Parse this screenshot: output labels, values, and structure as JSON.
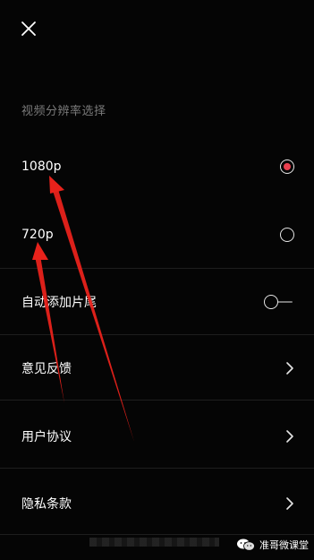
{
  "header": {
    "close_icon": "close-icon"
  },
  "resolution": {
    "section_title": "视频分辨率选择",
    "options": [
      {
        "label": "1080p",
        "selected": true
      },
      {
        "label": "720p",
        "selected": false
      }
    ]
  },
  "settings": {
    "auto_outro": {
      "label": "自动添加片尾",
      "enabled": false
    },
    "feedback": {
      "label": "意见反馈"
    },
    "user_agreement": {
      "label": "用户协议"
    },
    "privacy_policy": {
      "label": "隐私条款"
    }
  },
  "watermark": {
    "text": "准哥微课堂",
    "icon": "wechat-icon"
  },
  "colors": {
    "background": "#050505",
    "accent": "#e9404f",
    "annotation_arrow": "#e8221b",
    "section_text": "#7a7a7a",
    "divider": "#1e1e1e"
  }
}
